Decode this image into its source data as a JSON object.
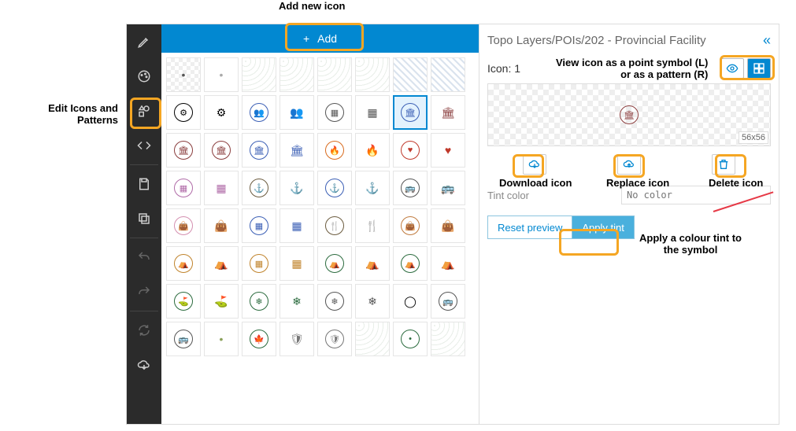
{
  "annotations": {
    "add_new_icon": "Add new icon",
    "edit_icons_patterns_1": "Edit Icons and",
    "edit_icons_patterns_2": "Patterns",
    "view_as_1": "View icon as a point symbol (L)",
    "view_as_2": "or as a pattern (R)",
    "download_icon": "Download icon",
    "replace_icon": "Replace icon",
    "delete_icon": "Delete icon",
    "apply_tint_1": "Apply a colour tint to",
    "apply_tint_2": "the symbol"
  },
  "toolbar": {
    "add_label": "Add"
  },
  "header": {
    "breadcrumb": "Topo Layers/POIs/202 - Provincial Facility"
  },
  "right_panel": {
    "icon_label": "Icon:",
    "icon_count": "1",
    "dim_label": "56x56",
    "tint_label": "Tint color",
    "tint_placeholder": "No color",
    "reset_label": "Reset preview",
    "apply_label": "Apply tint"
  },
  "icons": {
    "building": "🏛",
    "gear": "⚙",
    "anchor": "⚓",
    "fire": "🔥",
    "heart": "♥",
    "bus": "🚌",
    "cutlery": "🍴",
    "bag": "👜",
    "tent": "⛺",
    "leaf": "🍁",
    "shield": "🛡",
    "golf": "⛳",
    "sun": "❄",
    "grid": "▦",
    "dot": "•",
    "circle": "◯",
    "people": "👥"
  }
}
